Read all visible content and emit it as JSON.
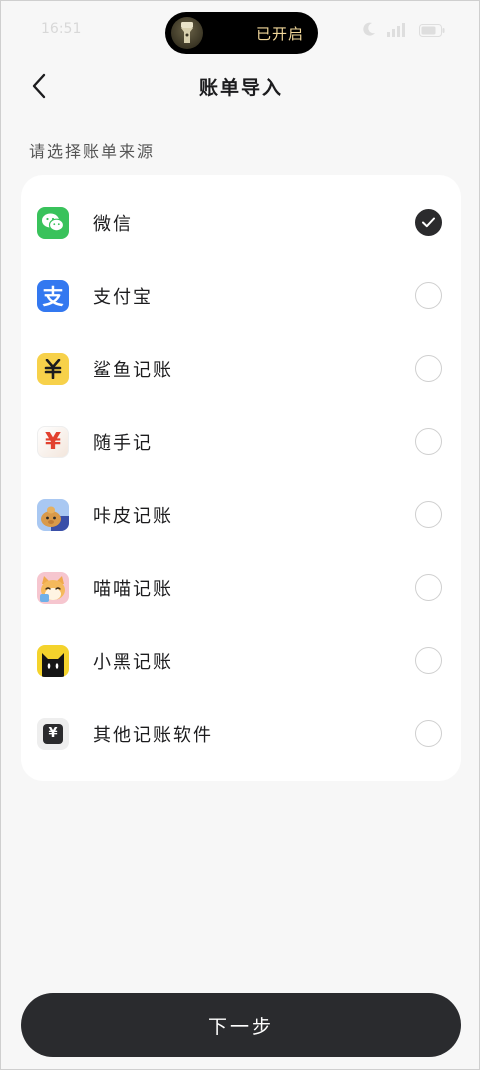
{
  "status_bar": {
    "time": "16:51",
    "island_text": "已开启",
    "colors": {
      "island_text": "#f1d79a"
    }
  },
  "header": {
    "title": "账单导入"
  },
  "section_label": "请选择账单来源",
  "sources": [
    {
      "label": "微信",
      "icon": "wechat-icon",
      "checked": true
    },
    {
      "label": "支付宝",
      "icon": "alipay-icon",
      "checked": false
    },
    {
      "label": "鲨鱼记账",
      "icon": "shark-icon",
      "checked": false
    },
    {
      "label": "随手记",
      "icon": "suishouji-icon",
      "checked": false
    },
    {
      "label": "咔皮记账",
      "icon": "kapi-icon",
      "checked": false
    },
    {
      "label": "喵喵记账",
      "icon": "cat-icon",
      "checked": false
    },
    {
      "label": "小黑记账",
      "icon": "black-cat-icon",
      "checked": false
    },
    {
      "label": "其他记账软件",
      "icon": "other-icon",
      "checked": false
    }
  ],
  "glyphs": {
    "yuan": "¥",
    "zhi": "支"
  },
  "next_button": {
    "label": "下一步"
  },
  "colors": {
    "button_bg": "#2a2b2e",
    "wechat": "#39c25b",
    "alipay": "#3378f0",
    "shark": "#f7d14a",
    "suishouji": "#e2402e"
  }
}
